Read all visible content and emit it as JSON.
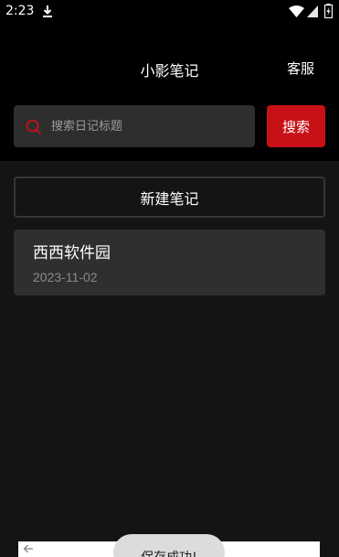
{
  "status_bar": {
    "time": "2:23",
    "icons": [
      "download-icon",
      "wifi-icon",
      "signal-icon",
      "battery-icon"
    ]
  },
  "header": {
    "title": "小影笔记",
    "service_label": "客服"
  },
  "search": {
    "placeholder": "搜索日记标题",
    "button_label": "搜索"
  },
  "actions": {
    "new_note_label": "新建笔记"
  },
  "notes": [
    {
      "title": "西西软件园",
      "date": "2023-11-02"
    }
  ],
  "toast": {
    "message": "保存成功!"
  },
  "colors": {
    "accent": "#c81017",
    "background": "#141414",
    "header_background": "#000000",
    "card": "#2f2f2f",
    "search_box": "#2e2e2e"
  }
}
